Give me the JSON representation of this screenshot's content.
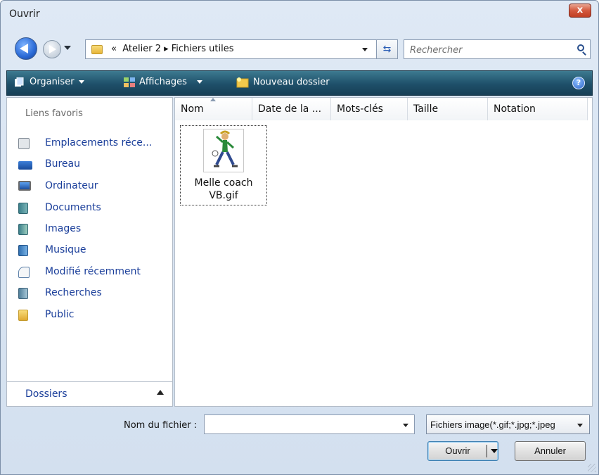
{
  "window": {
    "title": "Ouvrir",
    "close_label": "x"
  },
  "address": {
    "overflow": "«",
    "breadcrumbs": "Atelier 2 ▸ Fichiers utiles",
    "search_placeholder": "Rechercher"
  },
  "toolbar": {
    "organize": "Organiser",
    "views": "Affichages",
    "new_folder": "Nouveau dossier",
    "help": "?"
  },
  "nav": {
    "title": "Liens favoris",
    "items": [
      {
        "label": "Emplacements réce...",
        "icon": "recent-places-icon"
      },
      {
        "label": "Bureau",
        "icon": "desktop-icon"
      },
      {
        "label": "Ordinateur",
        "icon": "computer-icon"
      },
      {
        "label": "Documents",
        "icon": "documents-icon"
      },
      {
        "label": "Images",
        "icon": "pictures-icon"
      },
      {
        "label": "Musique",
        "icon": "music-icon"
      },
      {
        "label": "Modifié récemment",
        "icon": "recently-changed-icon"
      },
      {
        "label": "Recherches",
        "icon": "searches-icon"
      },
      {
        "label": "Public",
        "icon": "public-folder-icon"
      }
    ],
    "folders_label": "Dossiers"
  },
  "columns": [
    "Nom",
    "Date de la ...",
    "Mots-clés",
    "Taille",
    "Notation"
  ],
  "files": [
    {
      "name_line1": "Melle coach",
      "name_line2": "VB.gif"
    }
  ],
  "footer": {
    "filename_label": "Nom du fichier :",
    "filename_value": "",
    "filetype_value": "Fichiers image(*.gif;*.jpg;*.jpeg",
    "open_button": "Ouvrir",
    "cancel_button": "Annuler"
  },
  "colors": {
    "toolbar": "#1e4f69",
    "link": "#1a3e9a",
    "close": "#c13d22"
  }
}
